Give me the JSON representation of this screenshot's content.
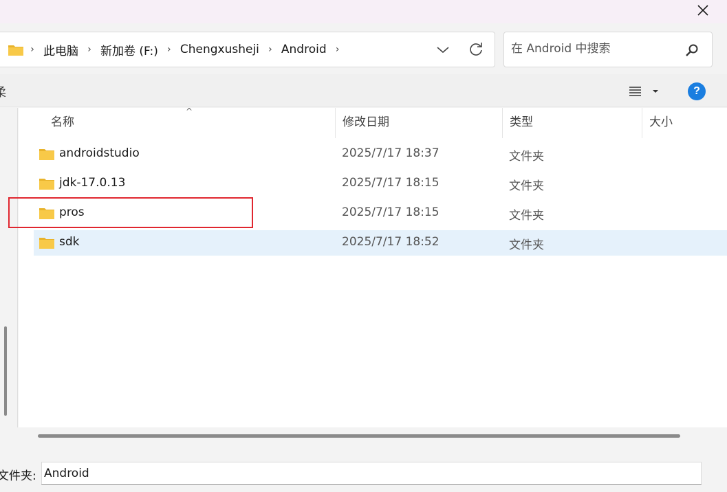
{
  "window": {
    "close_label": "close"
  },
  "address": {
    "crumbs": [
      "此电脑",
      "新加卷 (F:)",
      "Chengxusheji",
      "Android"
    ]
  },
  "search": {
    "placeholder": "在 Android 中搜索"
  },
  "toolbar": {
    "cut_text": "柔",
    "help_label": "?"
  },
  "columns": {
    "name": "名称",
    "modified": "修改日期",
    "type": "类型",
    "size": "大小"
  },
  "files": [
    {
      "name": "androidstudio",
      "modified": "2025/7/17 18:37",
      "type": "文件夹",
      "size": ""
    },
    {
      "name": "jdk-17.0.13",
      "modified": "2025/7/17 18:15",
      "type": "文件夹",
      "size": ""
    },
    {
      "name": "pros",
      "modified": "2025/7/17 18:15",
      "type": "文件夹",
      "size": ""
    },
    {
      "name": "sdk",
      "modified": "2025/7/17 18:52",
      "type": "文件夹",
      "size": ""
    }
  ],
  "selected_index": 3,
  "highlighted_index": 2,
  "footer": {
    "folder_label": "文件夹:",
    "folder_value": "Android"
  },
  "colors": {
    "accent": "#1a7ee0",
    "selection": "#e5f1fb",
    "highlight_border": "#e0262f",
    "folder": "#f8c948"
  }
}
